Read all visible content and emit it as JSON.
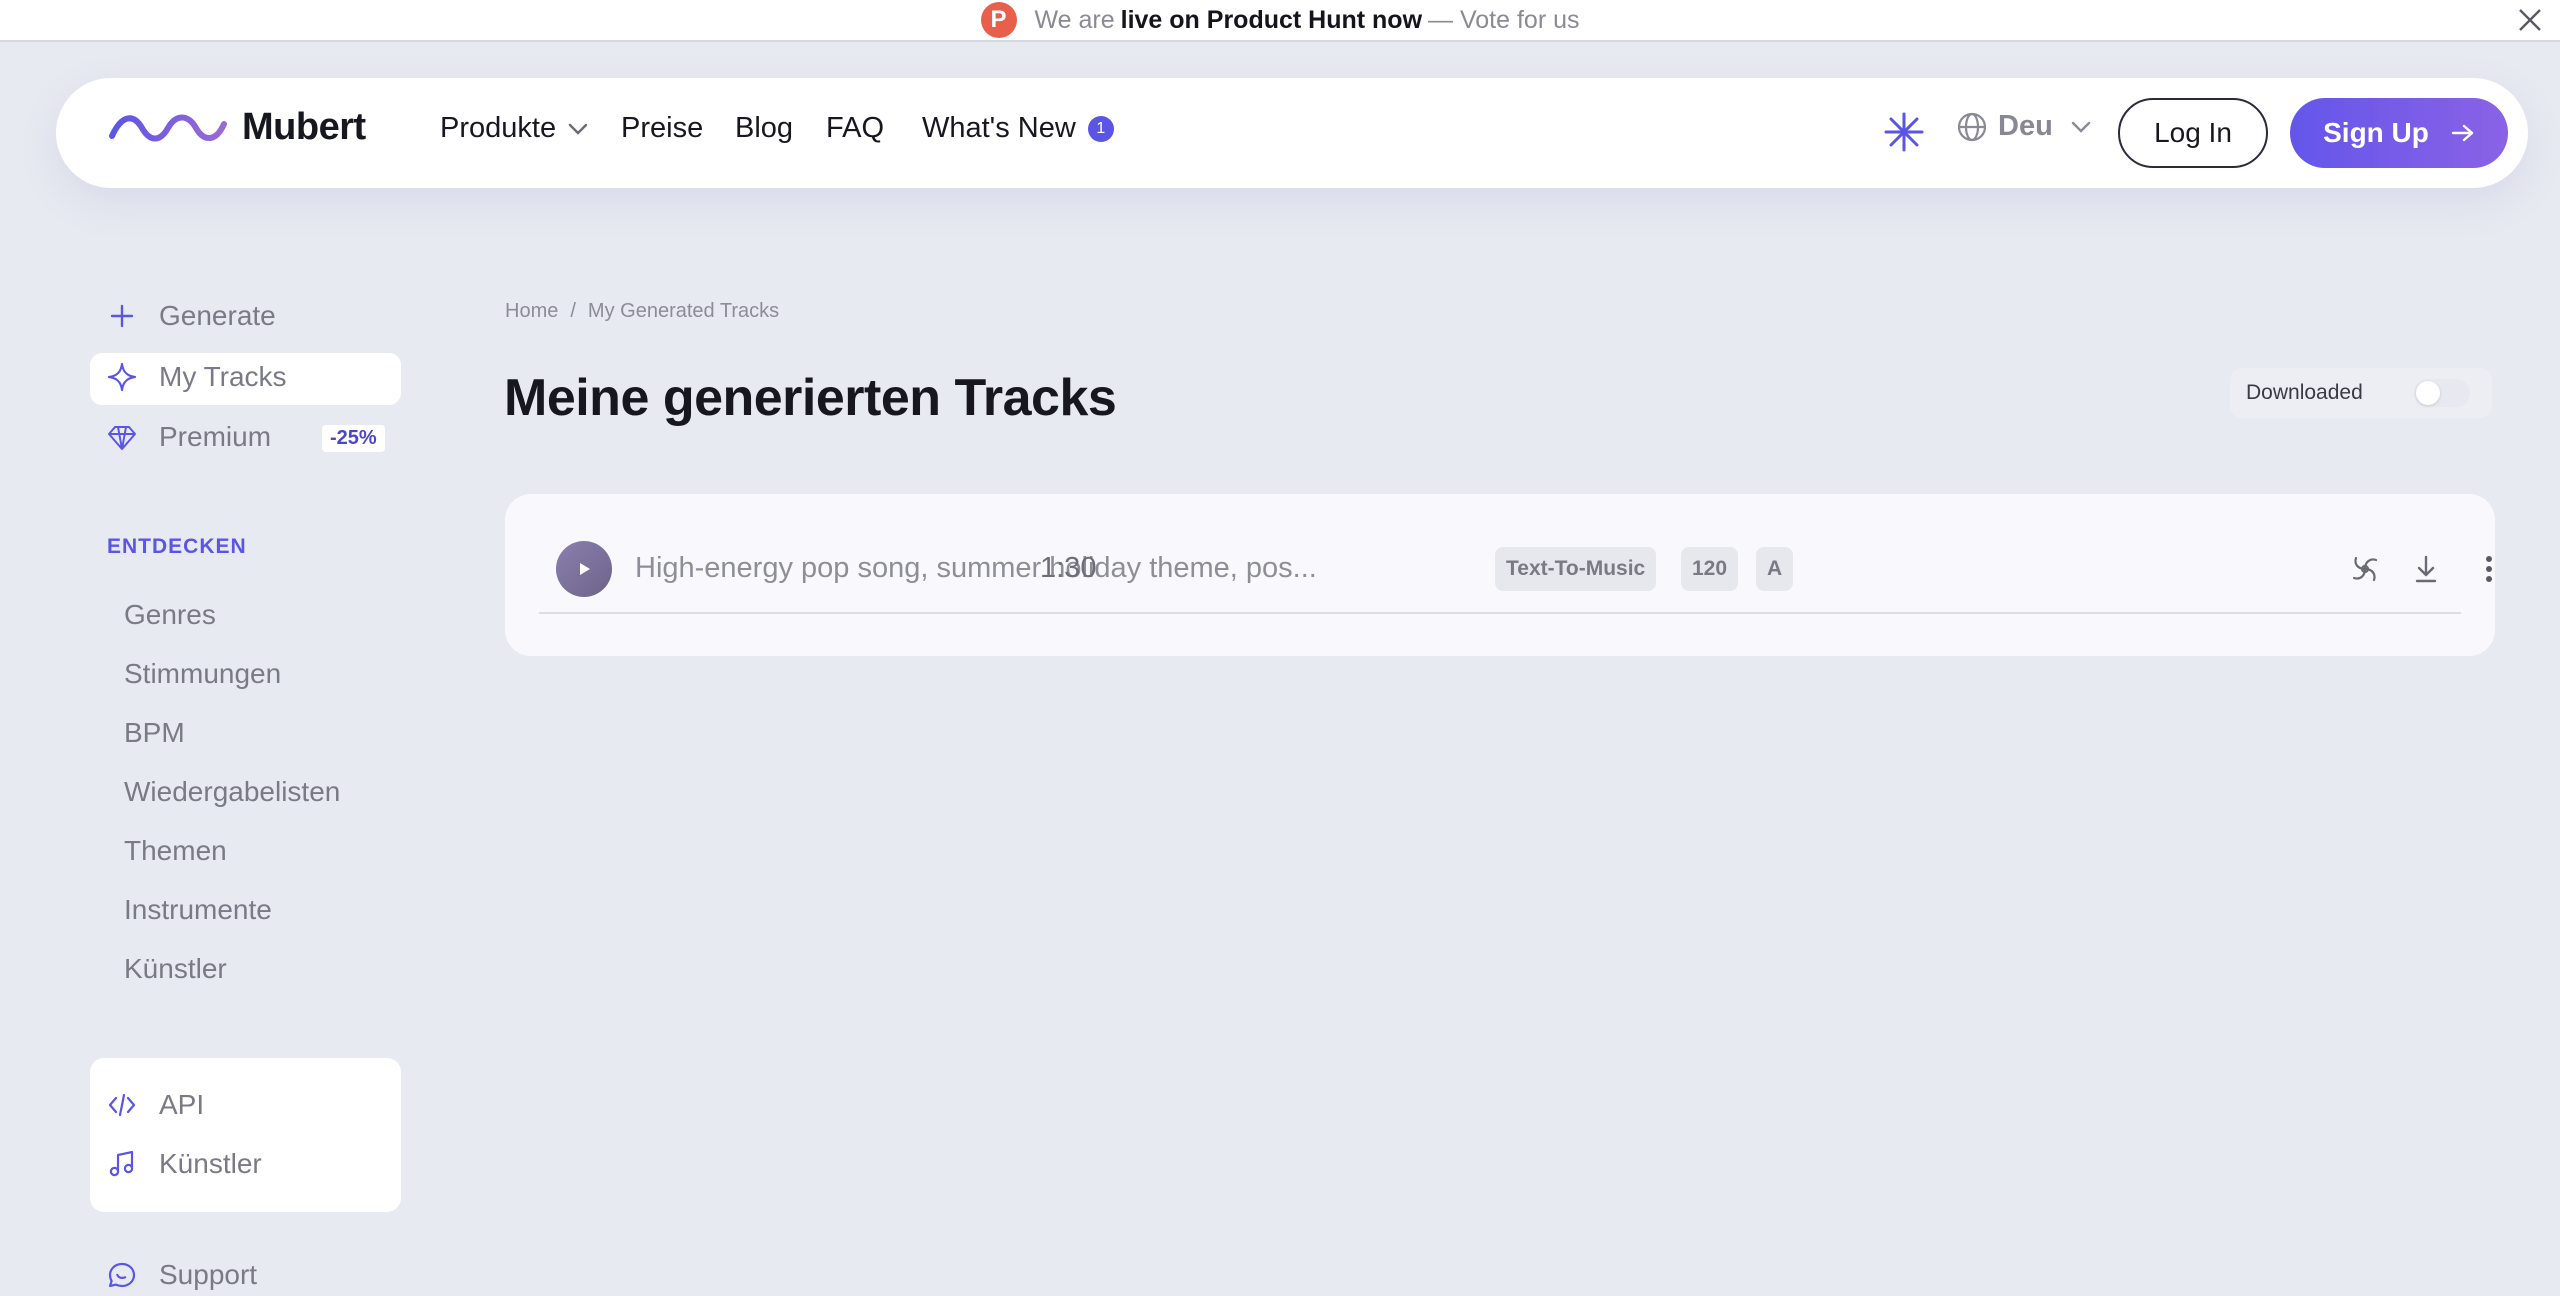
{
  "announcement": {
    "logo_letter": "P",
    "prefix": "We are",
    "strong": "live on Product Hunt now",
    "suffix": "— Vote for us"
  },
  "nav": {
    "brand": "Mubert",
    "links": [
      "Produkte",
      "Preise",
      "Blog",
      "FAQ",
      "What's New"
    ],
    "whats_new_badge": "1",
    "language": "Deu",
    "login": "Log In",
    "signup": "Sign Up"
  },
  "sidebar": {
    "primary": [
      {
        "label": "Generate",
        "icon": "plus-icon"
      },
      {
        "label": "My Tracks",
        "icon": "sparkle-icon",
        "active": true
      },
      {
        "label": "Premium",
        "icon": "diamond-icon",
        "badge": "-25%"
      }
    ],
    "section_title": "ENTDECKEN",
    "categories": [
      "Genres",
      "Stimmungen",
      "BPM",
      "Wiedergabelisten",
      "Themen",
      "Instrumente",
      "Künstler"
    ],
    "card_items": [
      {
        "label": "API",
        "icon": "code-icon"
      },
      {
        "label": "Künstler",
        "icon": "music-note-icon"
      }
    ],
    "support": "Support"
  },
  "main": {
    "breadcrumb": [
      "Home",
      "/",
      "My Generated Tracks"
    ],
    "title": "Meine generierten Tracks",
    "toggle_label": "Downloaded",
    "toggle_on": false,
    "tracks": [
      {
        "title": "High-energy pop song, summer holiday theme, pos...",
        "duration": "1:30",
        "tags": [
          "Text-To-Music",
          "120",
          "A"
        ]
      }
    ]
  },
  "colors": {
    "background": "#e8eaf1",
    "accent": "#5b55e6",
    "signup_gradient_end": "#8a62e6",
    "product_hunt": "#e8604c"
  }
}
